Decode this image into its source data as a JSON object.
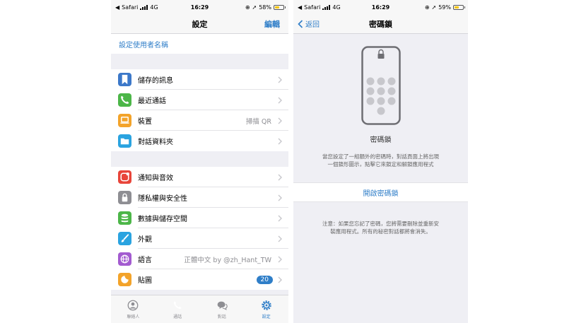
{
  "left": {
    "status": {
      "carrier": "Safari",
      "network": "4G",
      "time": "16:29",
      "battery": "58%",
      "battery_level": 0.58
    },
    "nav": {
      "title": "設定",
      "edit": "編輯"
    },
    "username_link": "設定使用者名稱",
    "group1": [
      {
        "label": "儲存的訊息",
        "icon": "bookmark-icon",
        "color": "#3c78c9"
      },
      {
        "label": "最近通話",
        "icon": "phone-icon",
        "color": "#4cb648"
      },
      {
        "label": "裝置",
        "icon": "laptop-icon",
        "color": "#f3a32a",
        "value": "掃描 QR"
      },
      {
        "label": "對話資料夾",
        "icon": "folder-icon",
        "color": "#2aa3e0"
      }
    ],
    "group2": [
      {
        "label": "通知與音效",
        "icon": "notification-icon",
        "color": "#e8453a"
      },
      {
        "label": "隱私權與安全性",
        "icon": "lock-icon",
        "color": "#8e8e93"
      },
      {
        "label": "數據與儲存空間",
        "icon": "database-icon",
        "color": "#4cb648"
      },
      {
        "label": "外觀",
        "icon": "brush-icon",
        "color": "#2aa3e0"
      },
      {
        "label": "語言",
        "icon": "globe-icon",
        "color": "#a35bd0",
        "value": "正體中文 by @zh_Hant_TW"
      },
      {
        "label": "貼圖",
        "icon": "sticker-icon",
        "color": "#f3a32a",
        "badge": "20"
      }
    ],
    "tabs": [
      {
        "label": "聯絡人",
        "icon": "contacts-icon",
        "active": false
      },
      {
        "label": "通話",
        "icon": "phone-icon",
        "active": false
      },
      {
        "label": "對話",
        "icon": "chats-icon",
        "active": false
      },
      {
        "label": "設定",
        "icon": "gear-icon",
        "active": true
      }
    ]
  },
  "right": {
    "status": {
      "carrier": "Safari",
      "network": "4G",
      "time": "16:29",
      "battery": "59%",
      "battery_level": 0.59
    },
    "nav": {
      "back": "返回",
      "title": "密碼鎖"
    },
    "passcode": {
      "title": "密碼鎖",
      "desc_line1": "當您設定了一組額外的密碼時，對話頁面上將出現",
      "desc_line2": "一個鎖形圖示，點擊它來鎖定和解鎖應用程式",
      "enable_button": "開啟密碼鎖",
      "note_line1": "注意：如果您忘記了密碼，您將需要刪除並重新安",
      "note_line2": "裝應用程式。所有的秘密對話都將會消失。"
    }
  },
  "colors": {
    "accent": "#2f7ec8",
    "background": "#efeff4",
    "bar": "#f7f7f7"
  }
}
